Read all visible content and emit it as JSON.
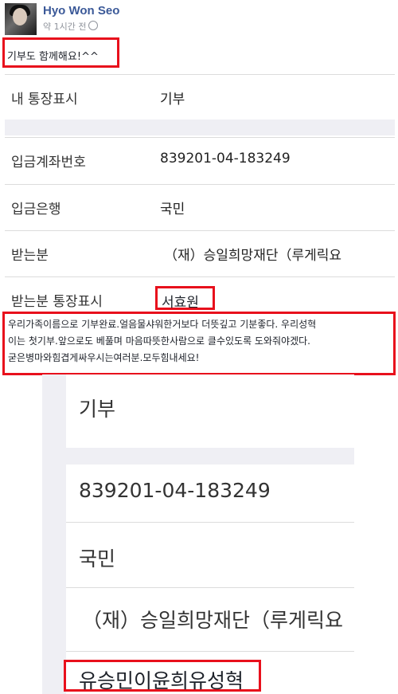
{
  "post": {
    "author": "Hyo Won Seo",
    "time": "약 1시간 전",
    "text": "기부도 함께해요!^^"
  },
  "shot1": {
    "rows": [
      {
        "label": "내 통장표시",
        "value": "기부"
      },
      {
        "label": "입금계좌번호",
        "value": "839201-04-183249"
      },
      {
        "label": "입금은행",
        "value": "국민"
      },
      {
        "label": "받는분",
        "value": "（재）승일희망재단（루게릭요"
      },
      {
        "label": "받는분 통장표시",
        "value": "서효원"
      }
    ]
  },
  "comment": [
    "우리가족이름으로 기부완료.얼음물샤워한거보다 더뜻깊고 기분좋다. 우리성혁",
    "이는 첫기부.앞으로도 베풀며 마음따뜻한사람으로 클수있도록 도와줘야겠다.",
    "굳은병마와힘겹게싸우시는여러분.모두힘내세요!"
  ],
  "shot2": {
    "memo": "기부",
    "account": "839201-04-183249",
    "bank": "국민",
    "recipient": "（재）승일희망재단（루게릭요",
    "names": "유승민이윤희유성혁"
  },
  "colors": {
    "highlight": "#e8101c",
    "author": "#3b5998"
  }
}
